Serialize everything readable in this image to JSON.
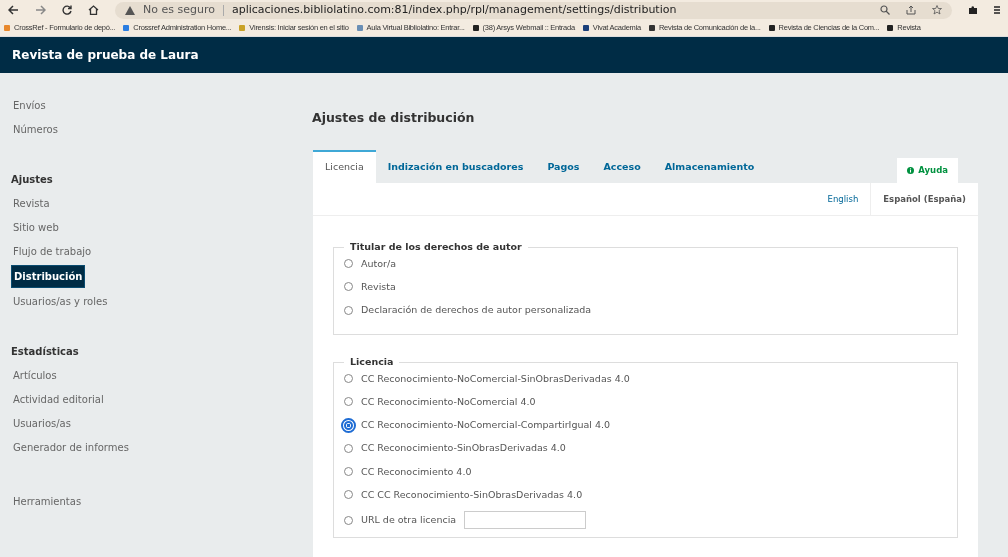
{
  "browser": {
    "security": "No es seguro",
    "url": "aplicaciones.bibliolatino.com:81/index.php/rpl/management/settings/distribution"
  },
  "bookmarks": [
    {
      "label": "CrossRef - Formulario de depó..."
    },
    {
      "label": "Crossref Administration Home..."
    },
    {
      "label": "Virensis: Iniciar sesión en el sitio"
    },
    {
      "label": "Aula Virtual Bibliolatino: Entrar..."
    },
    {
      "label": "(38) Arsys Webmail :: Entrada"
    },
    {
      "label": "Vivat Academia"
    },
    {
      "label": "Revista de Comunicación de la..."
    },
    {
      "label": "Revista de Ciencias de la Com..."
    },
    {
      "label": "Revista"
    }
  ],
  "header": {
    "title": "Revista de prueba de Laura"
  },
  "sidebar": [
    {
      "items": [
        {
          "label": "Envíos",
          "selected": false
        },
        {
          "label": "Números",
          "selected": false
        }
      ]
    },
    {
      "heading": "Ajustes",
      "items": [
        {
          "label": "Revista",
          "selected": false
        },
        {
          "label": "Sitio web",
          "selected": false
        },
        {
          "label": "Flujo de trabajo",
          "selected": false
        },
        {
          "label": "Distribución",
          "selected": true
        },
        {
          "label": "Usuarios/as y roles",
          "selected": false
        }
      ]
    },
    {
      "heading": "Estadísticas",
      "items": [
        {
          "label": "Artículos",
          "selected": false
        },
        {
          "label": "Actividad editorial",
          "selected": false
        },
        {
          "label": "Usuarios/as",
          "selected": false
        },
        {
          "label": "Generador de informes",
          "selected": false
        }
      ]
    },
    {
      "items": [
        {
          "label": "Herramientas",
          "selected": false
        }
      ]
    }
  ],
  "page_title": "Ajustes de distribución",
  "tabs": [
    {
      "label": "Licencia",
      "selected": true
    },
    {
      "label": "Indización en buscadores",
      "selected": false
    },
    {
      "label": "Pagos",
      "selected": false
    },
    {
      "label": "Acceso",
      "selected": false
    },
    {
      "label": "Almacenamiento",
      "selected": false
    }
  ],
  "help": "Ayuda",
  "languages": [
    {
      "label": "English",
      "selected": false
    },
    {
      "label": "Español (España)",
      "selected": true
    }
  ],
  "fieldsets": [
    {
      "legend": "Titular de los derechos de autor",
      "options": [
        {
          "kind": "radio",
          "label": "Autor/a",
          "selected": false
        },
        {
          "kind": "radio",
          "label": "Revista",
          "selected": false
        },
        {
          "kind": "radio",
          "label": "Declaración de derechos de autor personalizada",
          "selected": false
        }
      ]
    },
    {
      "legend": "Licencia",
      "options": [
        {
          "kind": "radio",
          "label": "CC Reconocimiento-NoComercial-SinObrasDerivadas 4.0",
          "selected": false
        },
        {
          "kind": "radio",
          "label": "CC Reconocimiento-NoComercial 4.0",
          "selected": false
        },
        {
          "kind": "radio",
          "label": "CC Reconocimiento-NoComercial-CompartirIgual 4.0",
          "selected": true
        },
        {
          "kind": "radio",
          "label": "CC Reconocimiento-SinObrasDerivadas 4.0",
          "selected": false
        },
        {
          "kind": "radio",
          "label": "CC Reconocimiento 4.0",
          "selected": false
        },
        {
          "kind": "radio",
          "label": "CC CC Reconocimiento-SinObrasDerivadas 4.0",
          "selected": false
        },
        {
          "kind": "url",
          "label": "URL de otra licencia",
          "selected": false
        }
      ]
    }
  ]
}
